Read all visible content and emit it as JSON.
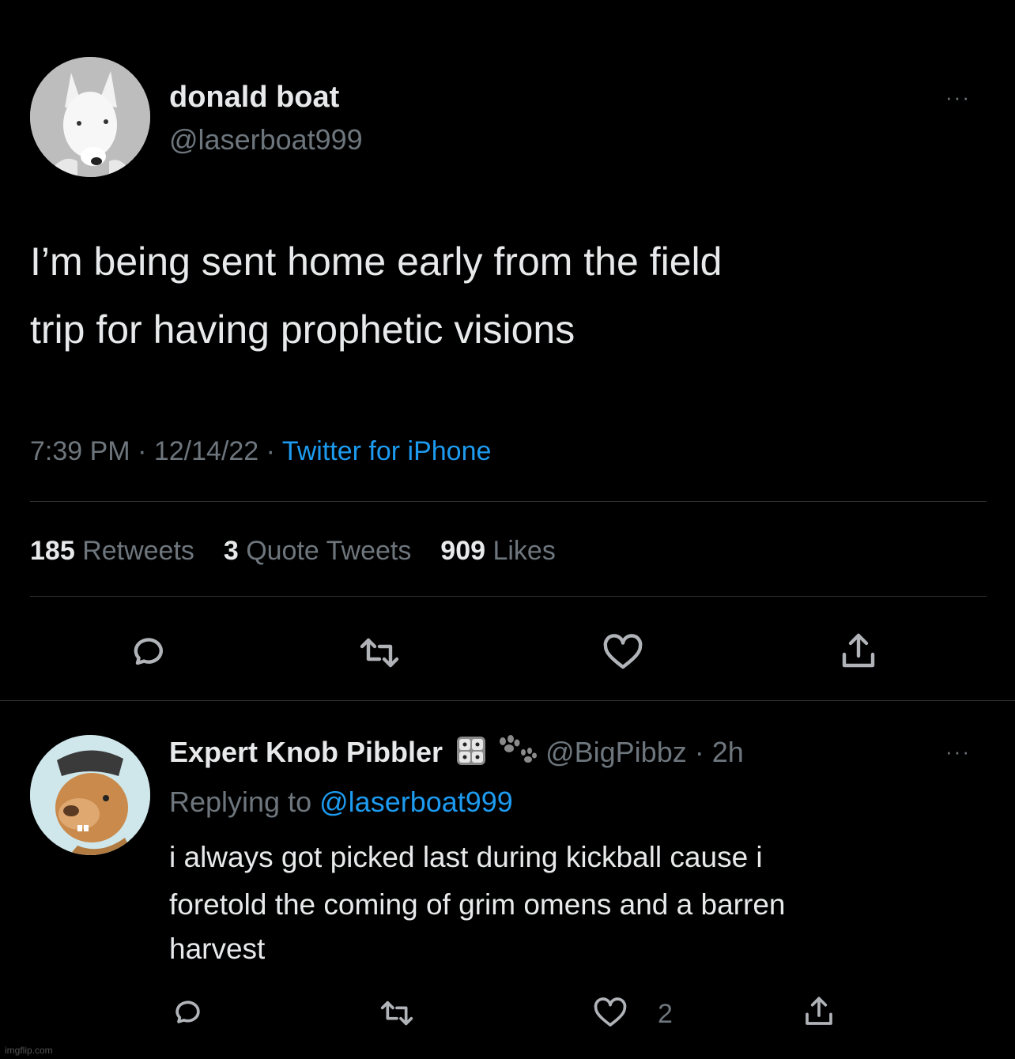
{
  "main_tweet": {
    "author_name": "donald boat",
    "author_handle": "@laserboat999",
    "text_line1": "I’m being sent home early from the field",
    "text_line2": "trip for having prophetic visions",
    "time": "7:39 PM",
    "date": "12/14/22",
    "source": "Twitter for iPhone",
    "sep": "·",
    "retweets_count": "185",
    "retweets_label": "Retweets",
    "quotes_count": "3",
    "quotes_label": "Quote Tweets",
    "likes_count": "909",
    "likes_label": "Likes",
    "more": "···"
  },
  "reply": {
    "author_name": "Expert Knob Pibbler",
    "author_handle": "@BigPibbz",
    "time": "2h",
    "sep": "·",
    "replying_label": "Replying to",
    "replying_handle": "@laserboat999",
    "text_line1": "i always got picked last during kickball cause i",
    "text_line2": "foretold the coming of grim omens and a barren",
    "text_line3": "harvest",
    "likes_count": "2",
    "more": "···"
  },
  "watermark": "imgflip.com",
  "colors": {
    "background": "#000000",
    "text": "#e7e9ea",
    "muted": "#6e767d",
    "link": "#1d9bf0"
  },
  "icons": [
    "reply-icon",
    "retweet-icon",
    "like-icon",
    "share-icon",
    "dice-emoji-icon",
    "paw-emoji-icon"
  ]
}
